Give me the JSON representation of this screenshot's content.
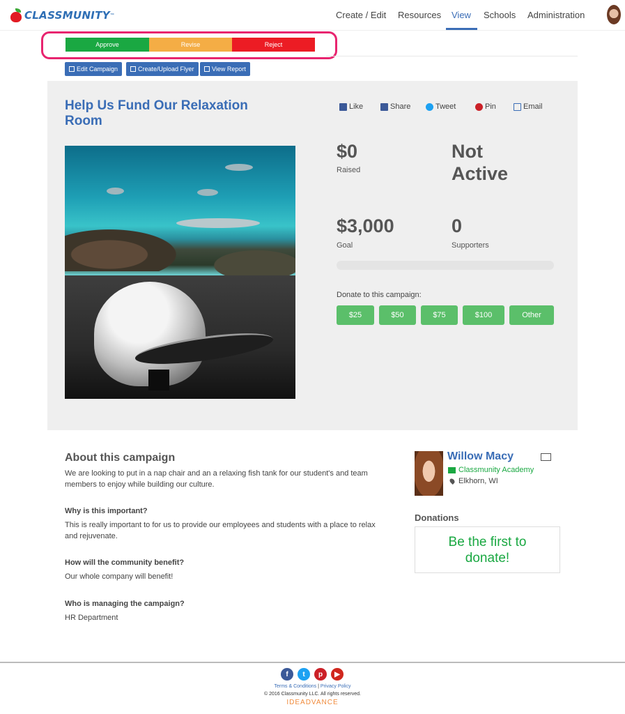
{
  "brand": {
    "logo_text": "CLASSMUNITY",
    "tm": "™"
  },
  "nav": {
    "items": [
      "Create / Edit",
      "Resources",
      "View",
      "Schools",
      "Administration"
    ],
    "active": "View"
  },
  "approval": {
    "approve": "Approve",
    "revise": "Revise",
    "reject": "Reject"
  },
  "toolbar": {
    "edit": "Edit Campaign",
    "flyer": "Create/Upload Flyer",
    "report": "View Report"
  },
  "campaign": {
    "title": "Help Us Fund Our Relaxation Room",
    "social": {
      "like": "Like",
      "share": "Share",
      "tweet": "Tweet",
      "pin": "Pin",
      "email": "Email"
    },
    "raised_value": "$0",
    "raised_label": "Raised",
    "status_value": "Not Active",
    "goal_value": "$3,000",
    "goal_label": "Goal",
    "supporters_value": "0",
    "supporters_label": "Supporters",
    "progress": 0,
    "donate_label": "Donate to this campaign:",
    "amounts": [
      "$25",
      "$50",
      "$75",
      "$100",
      "Other"
    ]
  },
  "about": {
    "heading": "About this campaign",
    "intro": "We are looking to put in a nap chair and an a relaxing fish tank for our student's and team members to enjoy while building our culture.",
    "q1": "Why is this important?",
    "a1": "This is really important to for us to provide our employees and students with a place to relax and rejuvenate.",
    "q2": "How will the community benefit?",
    "a2": "Our whole company will benefit!",
    "q3": "Who is managing the campaign?",
    "a3": "HR Department"
  },
  "manager": {
    "name": "Willow Macy",
    "school": "Classmunity Academy",
    "location": "Elkhorn, WI"
  },
  "donations": {
    "heading": "Donations",
    "empty": "Be the first to donate!"
  },
  "footer": {
    "social": [
      "f",
      "t",
      "p",
      "▶"
    ],
    "terms": "Terms & Conditions",
    "sep": "|",
    "privacy": "Privacy Policy",
    "copyright": "© 2016 Classmunity LLC. All rights reserved.",
    "brand": "IDEADVANCE"
  },
  "colors": {
    "accent": "#3a6db6",
    "approve": "#1aa842",
    "revise": "#f4ad45",
    "reject": "#ec1c24",
    "highlight": "#e8246f"
  }
}
